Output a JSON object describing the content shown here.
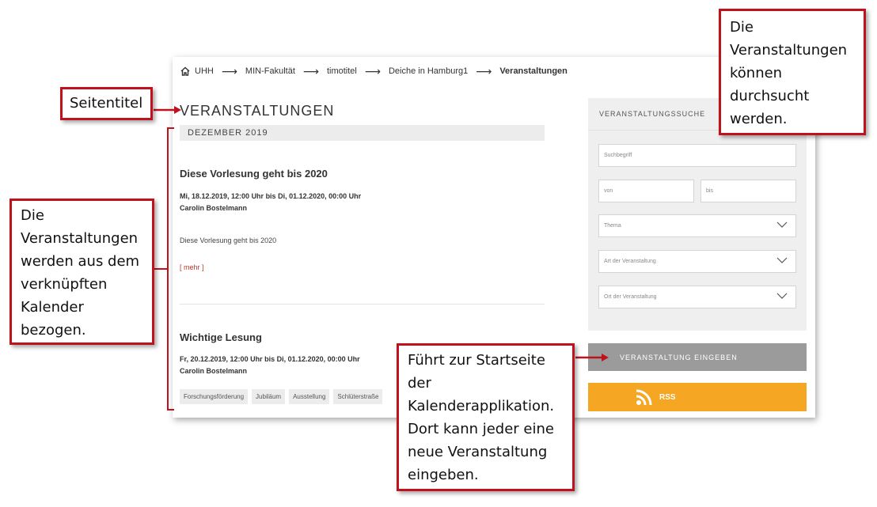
{
  "breadcrumb": {
    "items": [
      "UHH",
      "MIN-Fakultät",
      "timotitel",
      "Deiche in Hamburg1",
      "Veranstaltungen"
    ],
    "separator": "⟶"
  },
  "page_title": "VERANSTALTUNGEN",
  "month_header": "DEZEMBER 2019",
  "events": [
    {
      "title": "Diese Vorlesung geht bis 2020",
      "date": "Mi, 18.12.2019, 12:00 Uhr bis Di, 01.12.2020, 00:00 Uhr",
      "organizer": "Carolin Bostelmann",
      "description": "Diese Vorlesung geht bis 2020",
      "more_link": "[ mehr ]"
    },
    {
      "title": "Wichtige Lesung",
      "date": "Fr, 20.12.2019, 12:00 Uhr bis Di, 01.12.2020, 00:00 Uhr",
      "organizer": "Carolin Bostelmann",
      "tags": [
        "Forschungsförderung",
        "Jubiläum",
        "Ausstellung",
        "Schlüterstraße"
      ]
    }
  ],
  "search": {
    "heading": "VERANSTALTUNGSSUCHE",
    "keyword_placeholder": "Suchbegriff",
    "from_placeholder": "von",
    "to_placeholder": "bis",
    "topic_select": "Thema",
    "type_select": "Art der Veranstaltung",
    "location_select": "Ort der Veranstaltung"
  },
  "submit_button": "VERANSTALTUNG EINGEBEN",
  "rss_button": "RSS",
  "callouts": {
    "title": [
      "Seitentitel"
    ],
    "search": [
      "Die",
      "Veranstaltungen",
      "können",
      "durchsucht",
      "werden."
    ],
    "calendar": [
      "Die",
      "Veranstaltungen",
      "werden aus dem",
      "verknüpften",
      "Kalender",
      "bezogen."
    ],
    "submit": [
      "Führt zur Startseite",
      "der",
      "Kalenderapplikation.",
      "Dort kann jeder eine",
      "neue Veranstaltung",
      "eingeben."
    ]
  },
  "colors": {
    "callout_border": "#c0121d",
    "rss": "#f5a623",
    "submit": "#9b9b9b",
    "link": "#c0392b"
  }
}
